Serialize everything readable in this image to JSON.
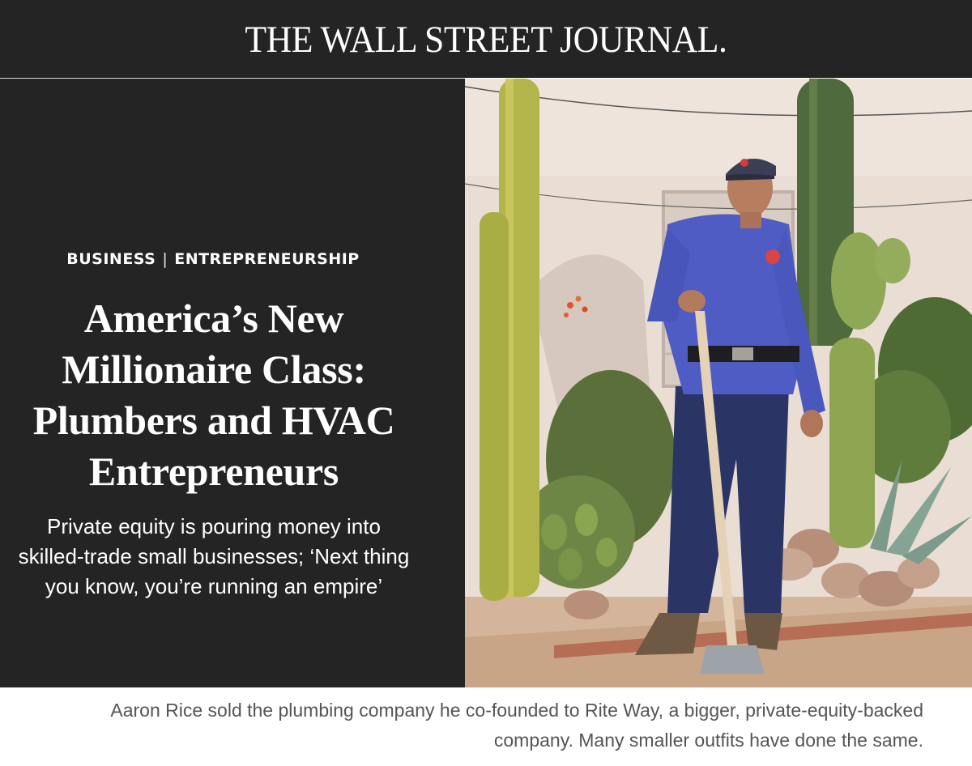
{
  "masthead": {
    "logo_text": "THE WALL STREET JOURNAL."
  },
  "article": {
    "section": "BUSINESS",
    "separator": "|",
    "subsection": "ENTREPRENEURSHIP",
    "headline": "America’s New Millionaire Class: Plumbers and HVAC Entrepreneurs",
    "dek": "Private equity is pouring money into skilled-trade small businesses; ‘Next thing you know, you’re running an empire’"
  },
  "photo": {
    "subject": "plumber-with-shovel-photo"
  },
  "caption": {
    "text": "Aaron Rice sold the plumbing company he co-founded to Rite Way, a bigger, private-equity-backed company. Many smaller outfits have done the same."
  },
  "colors": {
    "background_dark": "#242424",
    "text_light": "#ffffff",
    "caption_text": "#555555"
  }
}
